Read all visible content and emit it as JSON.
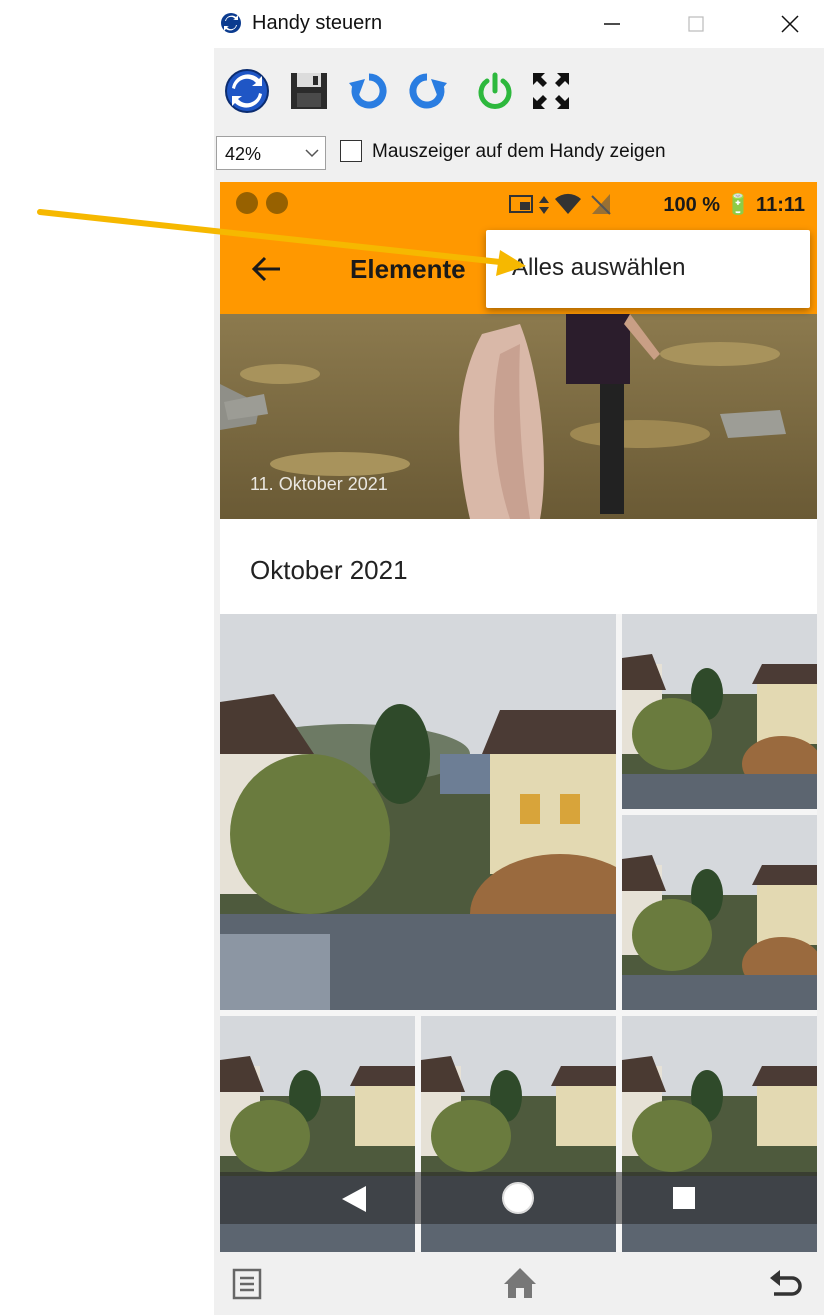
{
  "window": {
    "title": "Handy steuern",
    "controls": [
      "minimize",
      "maximize",
      "close"
    ]
  },
  "toolbar": {
    "buttons": [
      {
        "name": "refresh-icon"
      },
      {
        "name": "save-icon"
      },
      {
        "name": "rotate-left-icon"
      },
      {
        "name": "rotate-right-icon"
      },
      {
        "name": "power-icon"
      },
      {
        "name": "fullscreen-icon"
      }
    ]
  },
  "options": {
    "zoom_value": "42%",
    "show_cursor_label": "Mauszeiger auf dem Handy zeigen",
    "show_cursor_checked": false
  },
  "phone": {
    "status_bar": {
      "right_text": "100 % 🔋 11:11"
    },
    "app_bar": {
      "title": "Elemente"
    },
    "overflow_menu": {
      "items": [
        "Alles auswählen"
      ]
    },
    "top_photo_date": "11. Oktober 2021",
    "section_header": "Oktober 2021"
  },
  "colors": {
    "accent": "#ff9800",
    "annotation_arrow": "#f6b800"
  }
}
